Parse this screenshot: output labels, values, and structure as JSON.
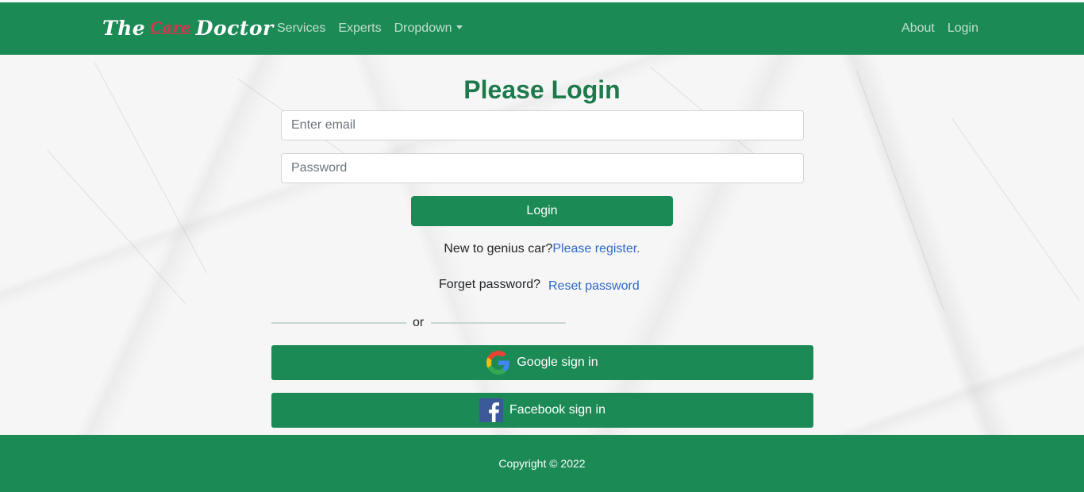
{
  "navbar": {
    "brand": {
      "part1": "The",
      "part2": "Care",
      "part3": "Doctor"
    },
    "links": [
      "Services",
      "Experts",
      "Dropdown"
    ],
    "right_links": [
      "About",
      "Login"
    ]
  },
  "form": {
    "title": "Please Login",
    "email_placeholder": "Enter email",
    "password_placeholder": "Password",
    "login_label": "Login",
    "register_prompt": "New to genius car?",
    "register_link": "Please register.",
    "forget_prompt": "Forget password?",
    "reset_link": "Reset password",
    "or_label": "or",
    "google_label": "Google sign in",
    "facebook_label": "Facebook sign in"
  },
  "footer": {
    "copyright": "Copyright © 2022"
  },
  "colors": {
    "primary": "#1c8a55",
    "title": "#1c7a4d",
    "link": "#2c69c8",
    "brand_accent": "#e0304e"
  }
}
